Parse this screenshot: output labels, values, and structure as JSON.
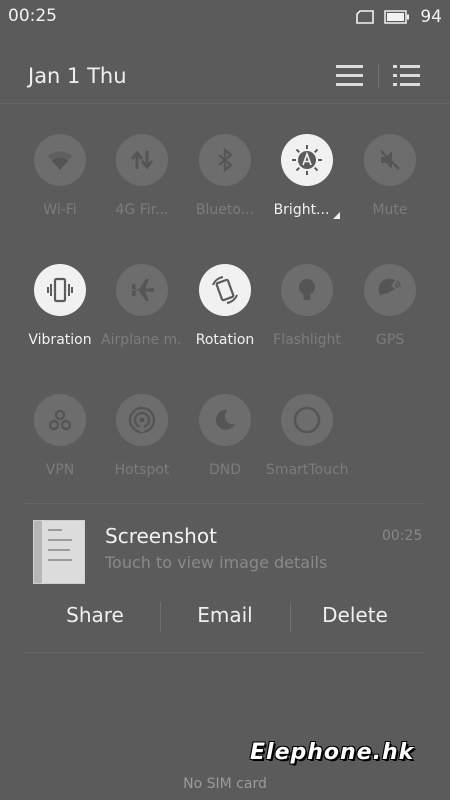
{
  "status_bar": {
    "time": "00:25",
    "battery_percent": "94",
    "icons": [
      "sim-card-icon",
      "battery-icon"
    ]
  },
  "header": {
    "date": "Jan 1  Thu",
    "icons": [
      "list-view-icon",
      "bulleted-list-icon"
    ]
  },
  "toggles": [
    {
      "label": "Wi-Fi",
      "icon": "wifi-icon",
      "active": false
    },
    {
      "label": "4G Fir...",
      "icon": "mobile-data-icon",
      "active": false
    },
    {
      "label": "Blueto...",
      "icon": "bluetooth-icon",
      "active": false
    },
    {
      "label": "Bright...",
      "icon": "brightness-auto-icon",
      "active": true
    },
    {
      "label": "Mute",
      "icon": "mute-icon",
      "active": false
    },
    {
      "label": "Vibration",
      "icon": "vibration-icon",
      "active": true
    },
    {
      "label": "Airplane m...",
      "icon": "airplane-icon",
      "active": false
    },
    {
      "label": "Rotation",
      "icon": "rotation-icon",
      "active": true
    },
    {
      "label": "Flashlight",
      "icon": "flashlight-icon",
      "active": false
    },
    {
      "label": "GPS",
      "icon": "gps-icon",
      "active": false
    },
    {
      "label": "VPN",
      "icon": "vpn-icon",
      "active": false
    },
    {
      "label": "Hotspot",
      "icon": "hotspot-icon",
      "active": false
    },
    {
      "label": "DND",
      "icon": "moon-icon",
      "active": false
    },
    {
      "label": "SmartTouch",
      "icon": "smarttouch-icon",
      "active": false
    }
  ],
  "notification": {
    "title": "Screenshot",
    "subtitle": "Touch to view image details",
    "time": "00:25",
    "actions": [
      "Share",
      "Email",
      "Delete"
    ]
  },
  "footer": {
    "carrier": "No SIM card"
  },
  "watermark": "Elephone.hk",
  "colors": {
    "background": "#5b5b5b",
    "tile_off": "#6d6d6d",
    "tile_on": "#f1f1f1",
    "label_off": "#7c7c7c"
  }
}
